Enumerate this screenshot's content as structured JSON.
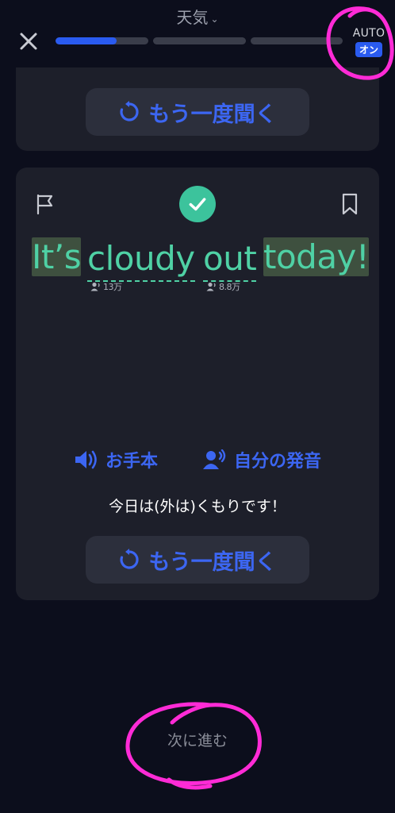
{
  "header": {
    "lesson_title": "天気",
    "progress": [
      0.66,
      0,
      0
    ],
    "auto_label": "AUTO",
    "auto_state": "オン"
  },
  "card_top": {
    "replay_label": "もう一度聞く"
  },
  "card_main": {
    "words": [
      {
        "text": "It’s",
        "highlight": true
      },
      {
        "text": "cloudy",
        "freq": "13万"
      },
      {
        "text": "out",
        "freq": "8.8万"
      },
      {
        "text": "today!",
        "highlight": true
      }
    ],
    "model_audio_label": "お手本",
    "own_audio_label": "自分の発音",
    "translation": "今日は(外は)くもりです！",
    "replay_label": "もう一度聞く"
  },
  "footer": {
    "next_label": "次に進む"
  },
  "colors": {
    "accent": "#2a5bf0",
    "success": "#3cc39c",
    "sentence": "#4fd1a5",
    "annotation": "#ff2bd6"
  }
}
